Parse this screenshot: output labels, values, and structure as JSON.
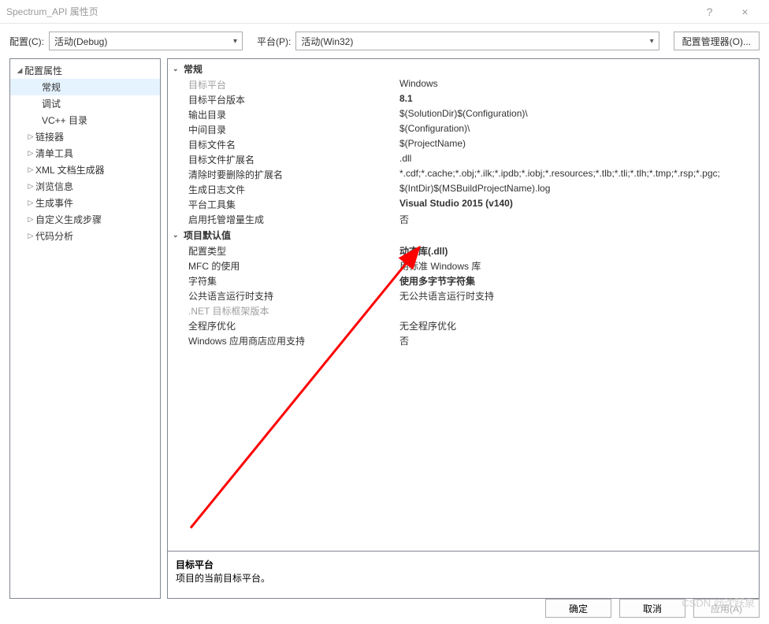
{
  "window": {
    "title": "Spectrum_API 属性页",
    "help": "?",
    "close": "×"
  },
  "toolbar": {
    "config_label": "配置(C):",
    "config_value": "活动(Debug)",
    "platform_label": "平台(P):",
    "platform_value": "活动(Win32)",
    "config_mgr": "配置管理器(O)..."
  },
  "tree": {
    "root": "配置属性",
    "items": [
      {
        "label": "常规",
        "selected": true
      },
      {
        "label": "调试"
      },
      {
        "label": "VC++ 目录"
      },
      {
        "label": "链接器",
        "expandable": true
      },
      {
        "label": "清单工具",
        "expandable": true
      },
      {
        "label": "XML 文档生成器",
        "expandable": true
      },
      {
        "label": "浏览信息",
        "expandable": true
      },
      {
        "label": "生成事件",
        "expandable": true
      },
      {
        "label": "自定义生成步骤",
        "expandable": true
      },
      {
        "label": "代码分析",
        "expandable": true
      }
    ]
  },
  "groups": [
    {
      "name": "常规",
      "rows": [
        {
          "k": "目标平台",
          "v": "Windows",
          "disabled": true
        },
        {
          "k": "目标平台版本",
          "v": "8.1",
          "bold": true
        },
        {
          "k": "输出目录",
          "v": "$(SolutionDir)$(Configuration)\\"
        },
        {
          "k": "中间目录",
          "v": "$(Configuration)\\"
        },
        {
          "k": "目标文件名",
          "v": "$(ProjectName)"
        },
        {
          "k": "目标文件扩展名",
          "v": ".dll"
        },
        {
          "k": "清除时要删除的扩展名",
          "v": "*.cdf;*.cache;*.obj;*.ilk;*.ipdb;*.iobj;*.resources;*.tlb;*.tli;*.tlh;*.tmp;*.rsp;*.pgc;"
        },
        {
          "k": "生成日志文件",
          "v": "$(IntDir)$(MSBuildProjectName).log"
        },
        {
          "k": "平台工具集",
          "v": "Visual Studio 2015 (v140)",
          "bold": true
        },
        {
          "k": "启用托管增量生成",
          "v": "否"
        }
      ]
    },
    {
      "name": "项目默认值",
      "rows": [
        {
          "k": "配置类型",
          "v": "动态库(.dll)",
          "bold": true
        },
        {
          "k": "MFC 的使用",
          "v": "    用标准 Windows 库"
        },
        {
          "k": "字符集",
          "v": "使用多字节字符集",
          "bold": true
        },
        {
          "k": "公共语言运行时支持",
          "v": "无公共语言运行时支持"
        },
        {
          "k": ".NET 目标框架版本",
          "v": "",
          "disabled": true
        },
        {
          "k": "全程序优化",
          "v": "无全程序优化"
        },
        {
          "k": "Windows 应用商店应用支持",
          "v": "否"
        }
      ]
    }
  ],
  "desc": {
    "title": "目标平台",
    "body": "项目的当前目标平台。"
  },
  "footer": {
    "ok": "确定",
    "cancel": "取消",
    "apply": "应用(A)"
  },
  "watermark": "CSDN @沈跃泉"
}
